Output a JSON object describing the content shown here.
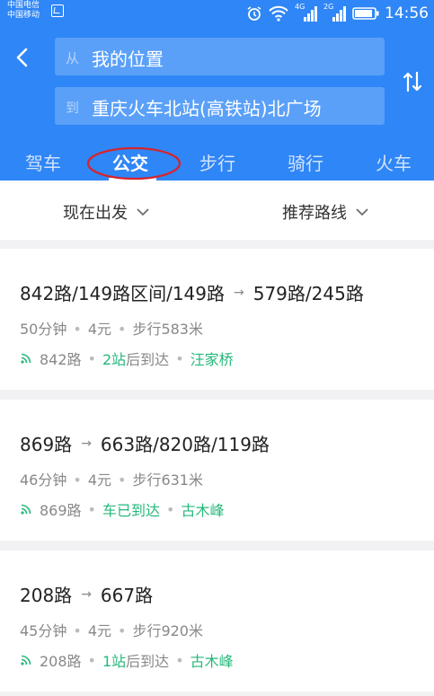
{
  "status_bar": {
    "carrier1": "中国电信",
    "carrier2": "中国移动",
    "net1": "4G",
    "net2": "2G",
    "time": "14:56"
  },
  "route": {
    "from_tag": "从",
    "from_text": "我的位置",
    "to_tag": "到",
    "to_text": "重庆火车北站(高铁站)北广场"
  },
  "tabs": [
    "驾车",
    "公交",
    "步行",
    "骑行",
    "火车"
  ],
  "active_tab_index": 1,
  "filters": {
    "depart": "现在出发",
    "sort": "推荐路线"
  },
  "results": [
    {
      "title_a": "842路/149路区间/149路",
      "title_b": "579路/245路",
      "duration": "50分钟",
      "price": "4元",
      "walk": "步行583米",
      "live_line": "842路",
      "live_status_num": "2站",
      "live_status_rest": "后到达",
      "stop": "汪家桥"
    },
    {
      "title_a": "869路",
      "title_b": "663路/820路/119路",
      "duration": "46分钟",
      "price": "4元",
      "walk": "步行631米",
      "live_line": "869路",
      "live_status_num": "车已到达",
      "live_status_rest": "",
      "stop": "古木峰"
    },
    {
      "title_a": "208路",
      "title_b": "667路",
      "duration": "45分钟",
      "price": "4元",
      "walk": "步行920米",
      "live_line": "208路",
      "live_status_num": "1站",
      "live_status_rest": "后到达",
      "stop": "古木峰"
    }
  ],
  "colors": {
    "header_blue": "#2f86f6",
    "accent_green": "#25b87a",
    "annotation_red": "#d9232a"
  }
}
